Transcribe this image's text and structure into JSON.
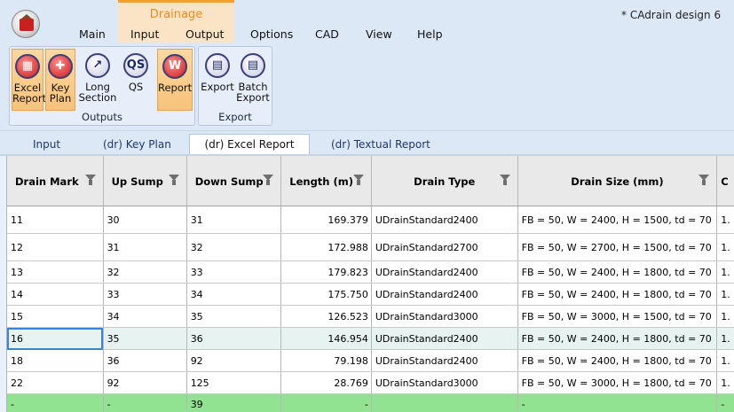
{
  "window": {
    "title": "* CAdrain design 6"
  },
  "context_tab": {
    "label": "Drainage"
  },
  "menu": [
    "Main",
    "Input",
    "Output",
    "Options",
    "CAD",
    "View",
    "Help"
  ],
  "ribbon": {
    "groups": [
      {
        "label": "Outputs",
        "buttons": [
          {
            "label1": "Excel",
            "label2": "Report",
            "icon": "excel-report-icon",
            "active": true
          },
          {
            "label1": "Key",
            "label2": "Plan",
            "icon": "key-plan-icon",
            "active": true
          },
          {
            "label1": "Long",
            "label2": "Section",
            "icon": "long-section-icon",
            "active": false
          },
          {
            "label1": "QS",
            "label2": "",
            "icon": "qs-icon",
            "active": false,
            "glyph": "QS"
          },
          {
            "label1": "Report",
            "label2": "",
            "icon": "report-icon",
            "active": true,
            "glyph": "W"
          }
        ]
      },
      {
        "label": "Export",
        "buttons": [
          {
            "label1": "Export",
            "label2": "",
            "icon": "export-icon",
            "active": false
          },
          {
            "label1": "Batch",
            "label2": "Export",
            "icon": "batch-export-icon",
            "active": false
          }
        ]
      }
    ]
  },
  "doc_tabs": [
    "Input",
    "(dr) Key Plan",
    "(dr) Excel Report",
    "(dr) Textual Report"
  ],
  "selected_doc_tab": 2,
  "table": {
    "columns": [
      "Drain Mark",
      "Up Sump",
      "Down Sump",
      "Length (m)",
      "Drain Type",
      "Drain Size (mm)",
      "C"
    ],
    "rows": [
      [
        "11",
        "30",
        "31",
        "169.379",
        "UDrainStandard2400",
        "FB = 50, W = 2400, H = 1500, td = 70",
        "1."
      ],
      [
        "12",
        "31",
        "32",
        "172.988",
        "UDrainStandard2700",
        "FB = 50, W = 2700, H = 1500, td = 70",
        "1."
      ],
      [
        "13",
        "32",
        "33",
        "179.823",
        "UDrainStandard2400",
        "FB = 50, W = 2400, H = 1800, td = 70",
        "1."
      ],
      [
        "14",
        "33",
        "34",
        "175.750",
        "UDrainStandard2400",
        "FB = 50, W = 2400, H = 1800, td = 70",
        "1."
      ],
      [
        "15",
        "34",
        "35",
        "126.523",
        "UDrainStandard3000",
        "FB = 50, W = 3000, H = 1500, td = 70",
        "1."
      ],
      [
        "16",
        "35",
        "36",
        "146.954",
        "UDrainStandard2400",
        "FB = 50, W = 2400, H = 1800, td = 70",
        "1."
      ],
      [
        "18",
        "36",
        "92",
        "79.198",
        "UDrainStandard2400",
        "FB = 50, W = 2400, H = 1800, td = 70",
        "1."
      ],
      [
        "22",
        "92",
        "125",
        "28.769",
        "UDrainStandard3000",
        "FB = 50, W = 3000, H = 1800, td = 70",
        "1."
      ],
      [
        "-",
        "-",
        "39",
        "-",
        "",
        "-",
        "-"
      ]
    ]
  },
  "colors": {
    "accent": "#e88a1e",
    "selected_row": "#e6f3f1",
    "summary_row": "#91e291",
    "ribbon_bg": "#dde8f6"
  }
}
